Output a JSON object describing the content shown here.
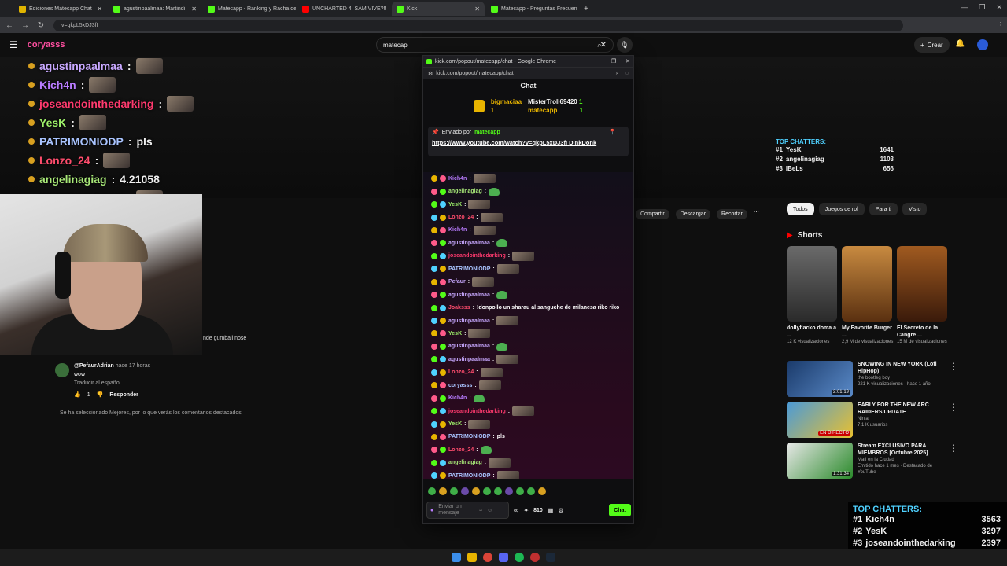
{
  "browser": {
    "tabs": [
      {
        "label": "Ediciones Matecapp Chat",
        "color": "#e0b400"
      },
      {
        "label": "agustinpaalmaa: Martindi",
        "color": "#53fc18"
      },
      {
        "label": "Matecapp - Ranking y Racha de",
        "color": "#53fc18"
      },
      {
        "label": "UNCHARTED 4. SAM VIVE?!! | C",
        "color": "#ff0000"
      },
      {
        "label": "Kick",
        "color": "#53fc18"
      },
      {
        "label": "Matecapp - Preguntas Frecuen",
        "color": "#53fc18"
      }
    ],
    "new_tab": "+",
    "url": "v=qkpL5xDJ3fI"
  },
  "youtube": {
    "search_value": "matecap",
    "create_label": "Crear",
    "logo_text": "coryasss",
    "chips": [
      "Todos",
      "Juegos de rol",
      "Para ti",
      "Visto"
    ],
    "actions": [
      "Compartir",
      "Descargar",
      "Recortar"
    ],
    "comment": {
      "author": "@PefaurAdrian",
      "time": "hace 17 horas",
      "text": "wow",
      "translate": "Traducir al español",
      "likes": "1",
      "reply": "Responder"
    },
    "best_note": "Se ha seleccionado Mejores, por lo que verás los comentarios destacados",
    "gumball_text": "nde gumball nose",
    "shorts_label": "Shorts",
    "shorts": [
      {
        "title": "dollyflacko doma a ...",
        "views": "12 K visualizaciones"
      },
      {
        "title": "My Favorite Burger ...",
        "views": "2,9 M de visualizaciones"
      },
      {
        "title": "El Secreto de la Cangre ...",
        "views": "15 M de visualizaciones"
      }
    ],
    "videos": [
      {
        "title": "SNOWING IN NEW YORK (Lofi HipHop)",
        "channel": "the bootleg boy",
        "meta": "221 K visualizaciones · hace 1 año",
        "duration": "2:01:19"
      },
      {
        "title": "EARLY FOR THE NEW ARC RAIDERS UPDATE",
        "channel": "Ninja",
        "meta": "7,1 K usuarios",
        "duration": "EN DIRECTO"
      },
      {
        "title": "Stream EXCLUSIVO PARA MIEMBROS [Octubre 2025]",
        "channel": "Mati en la Ciudad",
        "meta": "Emitido hace 1 mes · Destacado de YouTube",
        "duration": "1:31:34"
      }
    ]
  },
  "overlay_chat": [
    {
      "user": "agustinpaalmaa",
      "color": "#c8a8ff",
      "text": ""
    },
    {
      "user": "Kich4n",
      "color": "#b97cff",
      "text": ""
    },
    {
      "user": "joseandointhedarking",
      "color": "#ff3a6e",
      "text": ""
    },
    {
      "user": "YesK",
      "color": "#9ef06a",
      "text": ""
    },
    {
      "user": "PATRIMONIODP",
      "color": "#a9c4ff",
      "text": "pls"
    },
    {
      "user": "Lonzo_24",
      "color": "#ff4d6d",
      "text": ""
    },
    {
      "user": "angelinagiag",
      "color": "#a8e878",
      "text": "4.21058"
    },
    {
      "user": "PATRIMONIODP",
      "color": "#a9c4ff",
      "text": ""
    }
  ],
  "popup": {
    "window_title": "kick.com/popout/matecapp/chat - Google Chrome",
    "url": "kick.com/popout/matecapp/chat",
    "chat_title": "Chat",
    "gifters": [
      {
        "name": "bigmaciaa",
        "count": "1"
      },
      {
        "name": "MisterTroll69420",
        "count": "1"
      },
      {
        "name": "matecapp",
        "count": "1"
      }
    ],
    "pinned_by_label": "Enviado por",
    "pinned_by_user": "matecapp",
    "pinned_link": "https://www.youtube.com/watch?v=qkpL5xDJ3fI",
    "pinned_suffix": "DinkDonk",
    "messages": [
      {
        "user": "Kich4n",
        "color": "#b97cff",
        "text": ""
      },
      {
        "user": "angelinagiag",
        "color": "#a8e878",
        "text": ""
      },
      {
        "user": "YesK",
        "color": "#9ef06a",
        "text": ""
      },
      {
        "user": "Lonzo_24",
        "color": "#ff4d6d",
        "text": ""
      },
      {
        "user": "Kich4n",
        "color": "#b97cff",
        "text": ""
      },
      {
        "user": "agustinpaalmaa",
        "color": "#c8a8ff",
        "text": ""
      },
      {
        "user": "joseandointhedarking",
        "color": "#ff3a6e",
        "text": ""
      },
      {
        "user": "PATRIMONIODP",
        "color": "#a9c4ff",
        "text": ""
      },
      {
        "user": "Pefaur",
        "color": "#c8a8ff",
        "text": ""
      },
      {
        "user": "agustinpaalmaa",
        "color": "#c8a8ff",
        "text": ""
      },
      {
        "user": "Joaksss",
        "color": "#ff4d6d",
        "text": "!donpollo un sharau al sanguche de milanesa riko riko"
      },
      {
        "user": "agustinpaalmaa",
        "color": "#c8a8ff",
        "text": ""
      },
      {
        "user": "YesK",
        "color": "#9ef06a",
        "text": ""
      },
      {
        "user": "agustinpaalmaa",
        "color": "#c8a8ff",
        "text": ""
      },
      {
        "user": "agustinpaalmaa",
        "color": "#c8a8ff",
        "text": ""
      },
      {
        "user": "Lonzo_24",
        "color": "#ff4d6d",
        "text": ""
      },
      {
        "user": "coryasss",
        "color": "#a9c4ff",
        "text": ""
      },
      {
        "user": "Kich4n",
        "color": "#b97cff",
        "text": ""
      },
      {
        "user": "joseandointhedarking",
        "color": "#ff3a6e",
        "text": ""
      },
      {
        "user": "YesK",
        "color": "#9ef06a",
        "text": ""
      },
      {
        "user": "PATRIMONIODP",
        "color": "#a9c4ff",
        "text": "pls"
      },
      {
        "user": "Lonzo_24",
        "color": "#ff4d6d",
        "text": ""
      },
      {
        "user": "angelinagiag",
        "color": "#a8e878",
        "text": ""
      },
      {
        "user": "PATRIMONIODP",
        "color": "#a9c4ff",
        "text": ""
      }
    ],
    "input_placeholder": "Enviar un mensaje",
    "points": "810",
    "send_label": "Chat"
  },
  "top_chatters_small": {
    "title": "TOP CHATTERS:",
    "rows": [
      {
        "rank": "#1",
        "name": "YesK",
        "count": "1641"
      },
      {
        "rank": "#2",
        "name": "angelinagiag",
        "count": "1103"
      },
      {
        "rank": "#3",
        "name": "IBeLs",
        "count": "656"
      }
    ]
  },
  "top_chatters_big": {
    "title": "TOP CHATTERS:",
    "rows": [
      {
        "rank": "#1",
        "name": "Kich4n",
        "count": "3563"
      },
      {
        "rank": "#2",
        "name": "YesK",
        "count": "3297"
      },
      {
        "rank": "#3",
        "name": "joseandointhedarking",
        "count": "2397"
      }
    ]
  },
  "colors": {
    "kick_green": "#53fc18",
    "yt_bg": "#0f0f0f"
  }
}
